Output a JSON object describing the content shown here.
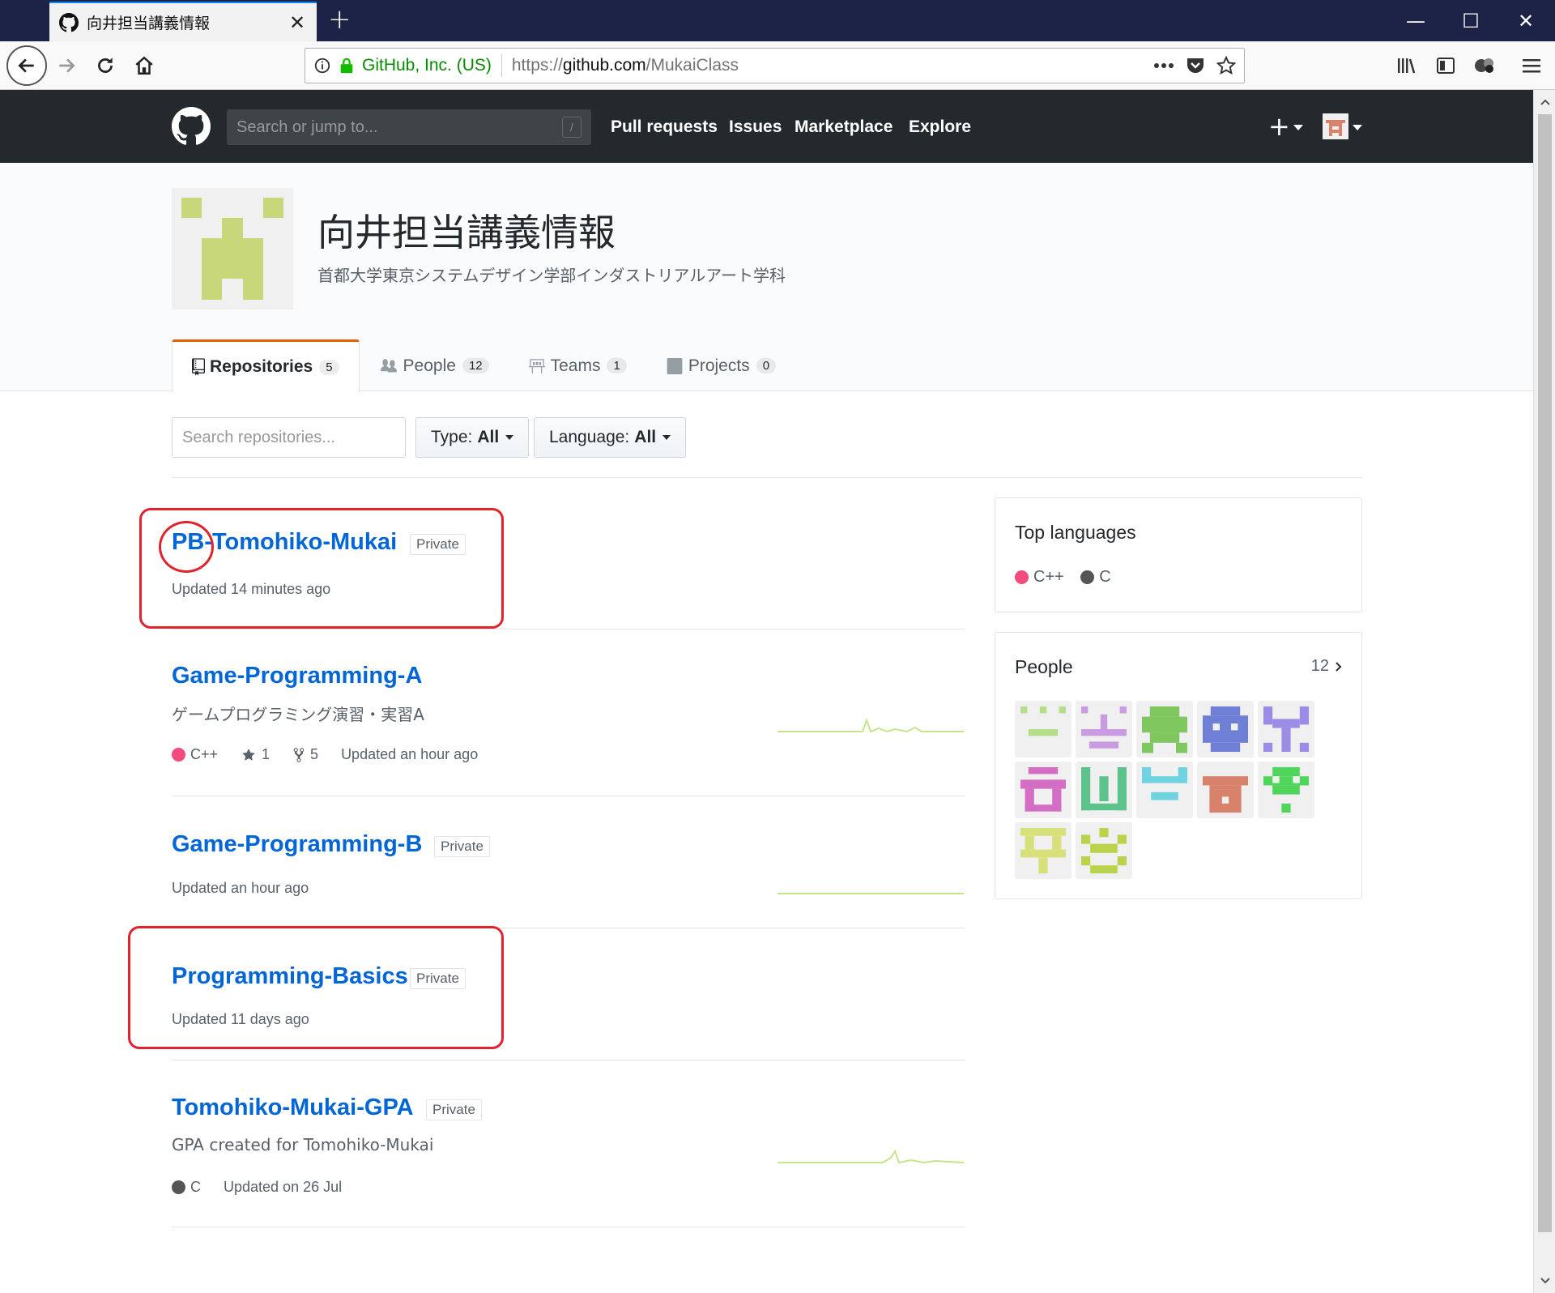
{
  "browser": {
    "tab_title": "向井担当講義情報",
    "tab_close": "✕",
    "new_tab": "+",
    "window_minimize": "—",
    "window_maximize": "☐",
    "window_close": "✕",
    "identity": "GitHub, Inc. (US)",
    "url_prefix": "https://",
    "url_host": "github.com",
    "url_path": "/MukaiClass"
  },
  "gh_header": {
    "search_placeholder": "Search or jump to...",
    "search_shortcut": "/",
    "nav": [
      "Pull requests",
      "Issues",
      "Marketplace",
      "Explore"
    ],
    "plus": "+"
  },
  "org": {
    "title": "向井担当講義情報",
    "description": "首都大学東京システムデザイン学部インダストリアルアート学科",
    "tabs": [
      {
        "label": "Repositories",
        "count": "5",
        "icon": "repo-icon",
        "selected": true
      },
      {
        "label": "People",
        "count": "12",
        "icon": "people-icon"
      },
      {
        "label": "Teams",
        "count": "1",
        "icon": "teams-icon"
      },
      {
        "label": "Projects",
        "count": "0",
        "icon": "project-icon"
      }
    ]
  },
  "filters": {
    "search_placeholder": "Search repositories...",
    "type_label": "Type:",
    "type_value": "All",
    "language_label": "Language:",
    "language_value": "All"
  },
  "repos": [
    {
      "name": "PB-Tomohiko-Mukai",
      "private": "Private",
      "updated": "Updated 14 minutes ago"
    },
    {
      "name": "Game-Programming-A",
      "description": "ゲームプログラミング演習・実習A",
      "language": "C++",
      "stars": "1",
      "forks": "5",
      "updated": "Updated an hour ago"
    },
    {
      "name": "Game-Programming-B",
      "private": "Private",
      "updated": "Updated an hour ago"
    },
    {
      "name": "Programming-Basics",
      "private": "Private",
      "updated": "Updated 11 days ago"
    },
    {
      "name": "Tomohiko-Mukai-GPA",
      "private": "Private",
      "description": "GPA created for Tomohiko-Mukai",
      "language": "C",
      "updated": "Updated on 26 Jul"
    }
  ],
  "sidebar": {
    "top_languages_title": "Top languages",
    "languages": [
      {
        "name": "C++",
        "color": "#f34b7d"
      },
      {
        "name": "C",
        "color": "#555555"
      }
    ],
    "people_title": "People",
    "people_count": "12"
  },
  "colors": {
    "link": "#0366d6",
    "header_bg": "#24292e",
    "annotation": "#e0242b",
    "cpp": "#f34b7d",
    "c": "#555555",
    "sparkline": "#c6e48b"
  }
}
